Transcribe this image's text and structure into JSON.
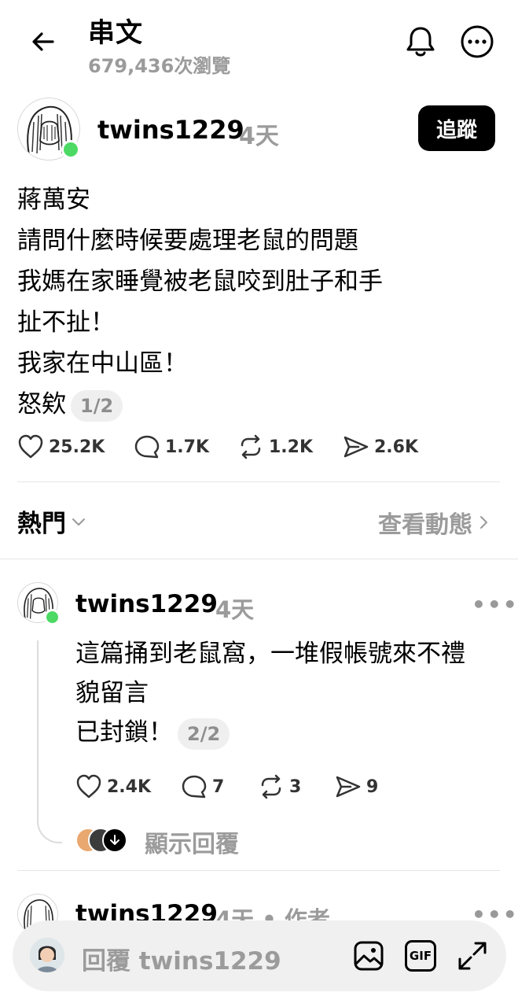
{
  "header": {
    "title": "串文",
    "views": "679,436次瀏覽"
  },
  "post": {
    "username": "twins1229",
    "time": "4天",
    "follow_label": "追蹤",
    "lines": [
      "蔣萬安",
      "請問什麼時候要處理老鼠的問題",
      "我媽在家睡覺被老鼠咬到肚子和手",
      "扯不扯！",
      "我家在中山區！",
      "怒欸"
    ],
    "pager": "1/2",
    "likes": "25.2K",
    "comments": "1.7K",
    "reposts": "1.2K",
    "shares": "2.6K"
  },
  "sort_bar": {
    "sort_label": "熱門",
    "view_activity": "查看動態"
  },
  "reply1": {
    "username": "twins1229",
    "time": "4天",
    "lines": [
      "這篇捅到老鼠窩，一堆假帳號來不禮",
      "貌留言",
      "已封鎖！"
    ],
    "pager": "2/2",
    "likes": "2.4K",
    "comments": "7",
    "reposts": "3",
    "shares": "9",
    "show_replies": "顯示回覆"
  },
  "reply2": {
    "username": "twins1229",
    "meta": "4天 • 作者"
  },
  "composer": {
    "placeholder": "回覆 twins1229",
    "gif_label": "GIF"
  },
  "colors": {
    "online": "#4cd964",
    "muted": "#9b9b9b",
    "follow_bg": "#000000"
  }
}
